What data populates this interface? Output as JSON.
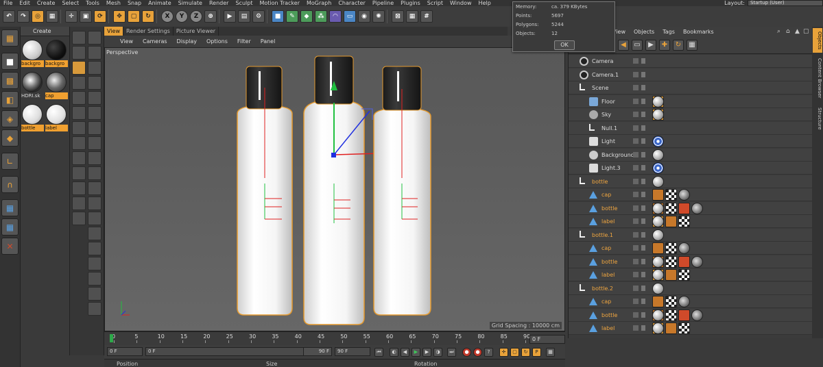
{
  "menubar": {
    "items": [
      "File",
      "Edit",
      "Create",
      "Select",
      "Tools",
      "Mesh",
      "Snap",
      "Animate",
      "Simulate",
      "Render",
      "Sculpt",
      "Motion Tracker",
      "MoGraph",
      "Character",
      "Pipeline",
      "Plugins",
      "Script",
      "Window",
      "Help"
    ],
    "layout_label": "Layout:",
    "layout_value": "Startup (User)"
  },
  "toolbar": {
    "axis_x": "X",
    "axis_y": "Y",
    "axis_z": "Z"
  },
  "info_popup": {
    "rows": [
      {
        "key": "Memory:",
        "value": "ca. 379 KBytes"
      },
      {
        "key": "Points:",
        "value": "5697"
      },
      {
        "key": "Polygons:",
        "value": "5244"
      },
      {
        "key": "Objects:",
        "value": "12"
      }
    ],
    "ok_label": "OK"
  },
  "material_manager": {
    "create_label": "Create",
    "materials": [
      {
        "label": "backgro",
        "color": "#e8e8e8",
        "selected": true
      },
      {
        "label": "backgro",
        "color": "#111111",
        "selected": true
      },
      {
        "label": "HDRI.sk",
        "color": "#9a9a9a",
        "selected": false
      },
      {
        "label": "cap",
        "color": "#c0c0c0",
        "selected": true
      },
      {
        "label": "bottle",
        "color": "#f0f0f0",
        "selected": true
      },
      {
        "label": "label",
        "color": "#eeeeee",
        "selected": true
      }
    ]
  },
  "viewport": {
    "tabs": [
      "View",
      "Render Settings",
      "Picture Viewer"
    ],
    "menu": [
      "View",
      "Cameras",
      "Display",
      "Options",
      "Filter",
      "Panel"
    ],
    "label": "Perspective",
    "grid_spacing": "Grid Spacing : 10000 cm"
  },
  "object_manager": {
    "menu": [
      "View",
      "Objects",
      "Tags",
      "Bookmarks"
    ],
    "rows": [
      {
        "name": "Camera",
        "indent": 0,
        "icon": "camera-icon",
        "iconClass": "cam",
        "orange": false,
        "tags": []
      },
      {
        "name": "Camera.1",
        "indent": 0,
        "icon": "camera-icon",
        "iconClass": "cam",
        "orange": false,
        "tags": []
      },
      {
        "name": "Scene",
        "indent": 0,
        "icon": "null-icon",
        "iconClass": "null",
        "orange": false,
        "tags": []
      },
      {
        "name": "Floor",
        "indent": 1,
        "icon": "floor-icon",
        "iconClass": "floor",
        "orange": false,
        "tags": [
          "comp",
          "mat"
        ]
      },
      {
        "name": "Sky",
        "indent": 1,
        "icon": "sky-icon",
        "iconClass": "sky",
        "orange": false,
        "tags": [
          "comp",
          "mat"
        ]
      },
      {
        "name": "Null.1",
        "indent": 1,
        "icon": "null-icon",
        "iconClass": "null",
        "orange": false,
        "tags": []
      },
      {
        "name": "Light",
        "indent": 1,
        "icon": "light-icon",
        "iconClass": "light",
        "orange": false,
        "tags": [
          "target"
        ]
      },
      {
        "name": "Background",
        "indent": 1,
        "icon": "background-icon",
        "iconClass": "bg",
        "orange": false,
        "tags": [
          "mat"
        ]
      },
      {
        "name": "Light.3",
        "indent": 1,
        "icon": "light-icon",
        "iconClass": "light",
        "orange": false,
        "tags": [
          "target"
        ]
      },
      {
        "name": "bottle",
        "indent": 0,
        "icon": "null-icon",
        "iconClass": "null",
        "orange": true,
        "tags": [
          "mat"
        ]
      },
      {
        "name": "cap",
        "indent": 1,
        "icon": "lathe-icon",
        "iconClass": "tri",
        "orange": true,
        "tags": [
          "phong",
          "check",
          "chrome"
        ]
      },
      {
        "name": "bottle",
        "indent": 1,
        "icon": "lathe-icon",
        "iconClass": "tri",
        "orange": true,
        "tags": [
          "phong",
          "check",
          "tri",
          "mat",
          "chrome"
        ]
      },
      {
        "name": "label",
        "indent": 1,
        "icon": "lathe-icon",
        "iconClass": "tri",
        "orange": true,
        "tags": [
          "comp",
          "mat",
          "phong",
          "check"
        ]
      },
      {
        "name": "bottle.1",
        "indent": 0,
        "icon": "null-icon",
        "iconClass": "null",
        "orange": true,
        "tags": [
          "mat"
        ]
      },
      {
        "name": "cap",
        "indent": 1,
        "icon": "lathe-icon",
        "iconClass": "tri",
        "orange": true,
        "tags": [
          "phong",
          "check",
          "chrome"
        ]
      },
      {
        "name": "bottle",
        "indent": 1,
        "icon": "lathe-icon",
        "iconClass": "tri",
        "orange": true,
        "tags": [
          "phong",
          "check",
          "tri",
          "mat",
          "chrome"
        ]
      },
      {
        "name": "label",
        "indent": 1,
        "icon": "lathe-icon",
        "iconClass": "tri",
        "orange": true,
        "tags": [
          "comp",
          "mat",
          "phong",
          "check"
        ]
      },
      {
        "name": "bottle.2",
        "indent": 0,
        "icon": "null-icon",
        "iconClass": "null",
        "orange": true,
        "tags": [
          "mat"
        ]
      },
      {
        "name": "cap",
        "indent": 1,
        "icon": "lathe-icon",
        "iconClass": "tri",
        "orange": true,
        "tags": [
          "phong",
          "check",
          "chrome"
        ]
      },
      {
        "name": "bottle",
        "indent": 1,
        "icon": "lathe-icon",
        "iconClass": "tri",
        "orange": true,
        "tags": [
          "phong",
          "check",
          "tri",
          "mat",
          "chrome"
        ]
      },
      {
        "name": "label",
        "indent": 1,
        "icon": "lathe-icon",
        "iconClass": "tri",
        "orange": true,
        "tags": [
          "comp",
          "mat",
          "phong",
          "check"
        ]
      }
    ]
  },
  "side_tabs": [
    "Objects",
    "Content Browser",
    "Structure"
  ],
  "timeline": {
    "ticks": [
      "0",
      "5",
      "10",
      "15",
      "20",
      "25",
      "30",
      "35",
      "40",
      "45",
      "50",
      "55",
      "60",
      "65",
      "70",
      "75",
      "80",
      "85",
      "90"
    ],
    "current_frame": "0 F"
  },
  "transport": {
    "start_field": "0 F",
    "min_field": "0 F",
    "max_field": "90 F",
    "end_field": "90 F"
  },
  "attributes": {
    "position_label": "Position",
    "size_label": "Size",
    "rotation_label": "Rotation"
  },
  "colors": {
    "accent": "#e8a23a",
    "axis_x": "#e02020",
    "axis_y": "#20c040",
    "axis_z": "#2030e0"
  }
}
